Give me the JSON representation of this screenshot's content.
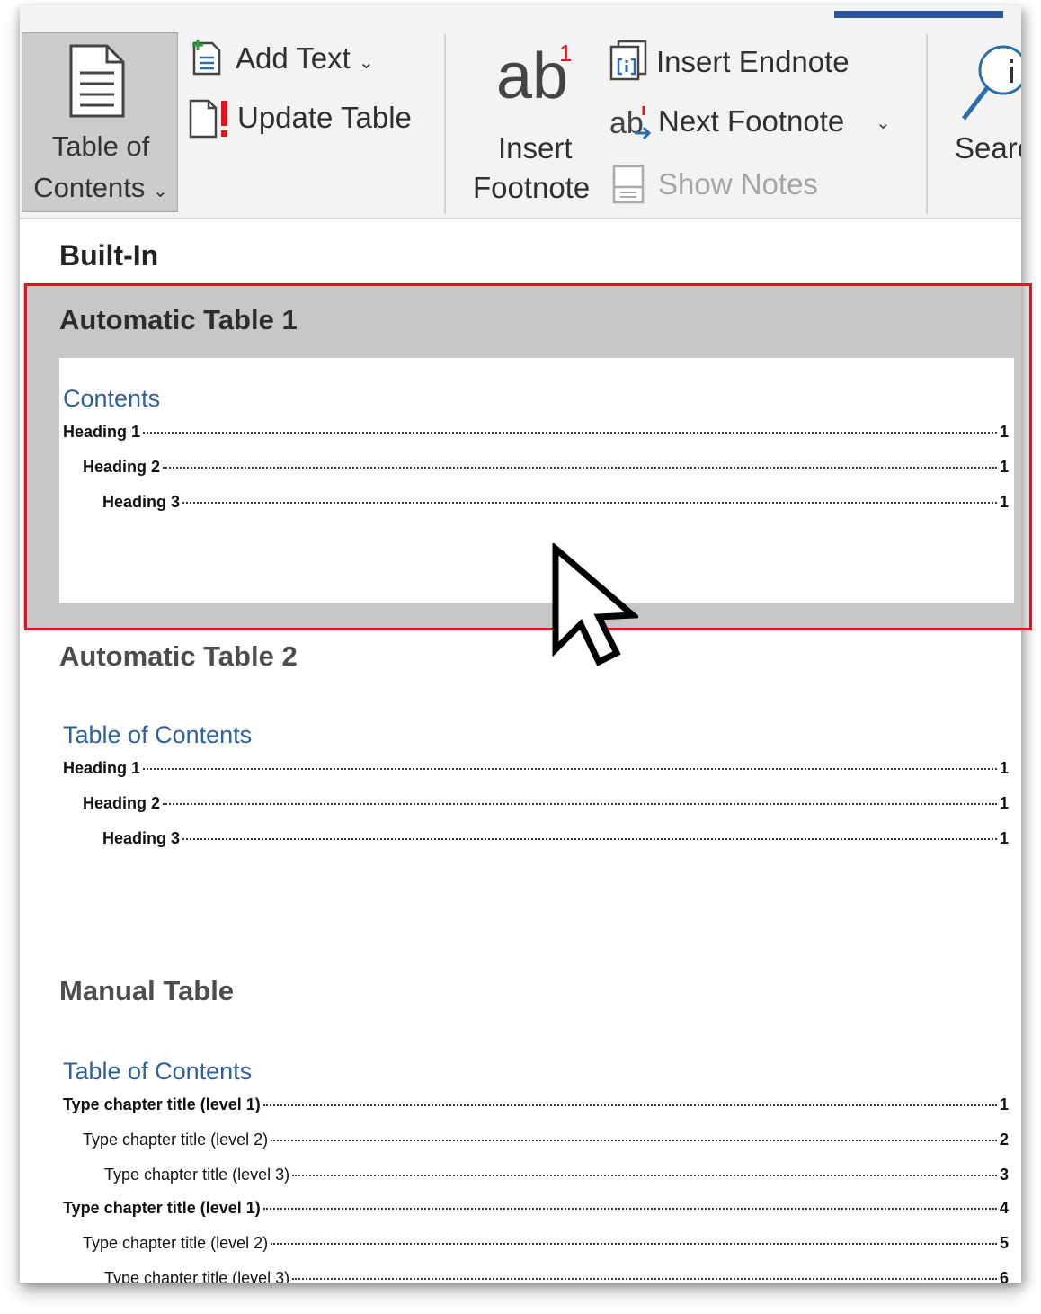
{
  "ribbon": {
    "toc_button": {
      "line1": "Table of",
      "line2": "Contents",
      "icon": "document-lines-icon"
    },
    "add_text": {
      "label": "Add Text",
      "icon": "add-text-icon"
    },
    "update_table": {
      "label": "Update Table",
      "icon": "update-table-icon"
    },
    "insert_footnote": {
      "line1": "Insert",
      "line2": "Footnote",
      "glyph": "ab",
      "sup": "1"
    },
    "insert_endnote": {
      "label": "Insert Endnote",
      "icon": "insert-endnote-icon"
    },
    "next_footnote": {
      "label": "Next Footnote",
      "icon": "next-footnote-icon"
    },
    "show_notes": {
      "label": "Show Notes",
      "icon": "show-notes-icon",
      "disabled": true
    },
    "search": {
      "label": "Searc",
      "icon": "search-icon"
    },
    "accent_color": "#2b579a"
  },
  "gallery": {
    "section_label": "Built-In",
    "items": [
      {
        "title": "Automatic Table 1",
        "heading": "Contents",
        "entries": [
          {
            "text": "Heading 1",
            "page": "1",
            "level": 1
          },
          {
            "text": "Heading 2",
            "page": "1",
            "level": 2
          },
          {
            "text": "Heading 3",
            "page": "1",
            "level": 3
          }
        ]
      },
      {
        "title": "Automatic Table 2",
        "heading": "Table of Contents",
        "entries": [
          {
            "text": "Heading 1",
            "page": "1",
            "level": 1
          },
          {
            "text": "Heading 2",
            "page": "1",
            "level": 2
          },
          {
            "text": "Heading 3",
            "page": "1",
            "level": 3
          }
        ]
      },
      {
        "title": "Manual Table",
        "heading": "Table of Contents",
        "entries": [
          {
            "text": "Type chapter title (level 1)",
            "page": "1",
            "level": 1
          },
          {
            "text": "Type chapter title (level 2)",
            "page": "2",
            "level": 2
          },
          {
            "text": "Type chapter title (level 3)",
            "page": "3",
            "level": 3
          },
          {
            "text": "Type chapter title (level 1)",
            "page": "4",
            "level": 1
          },
          {
            "text": "Type chapter title (level 2)",
            "page": "5",
            "level": 2
          }
        ],
        "cut_off_entry": {
          "text": "Type chapter title (level 3)",
          "page": "6"
        }
      }
    ]
  },
  "highlight_color": "#e8121a",
  "cursor_icon": "mouse-pointer-icon"
}
